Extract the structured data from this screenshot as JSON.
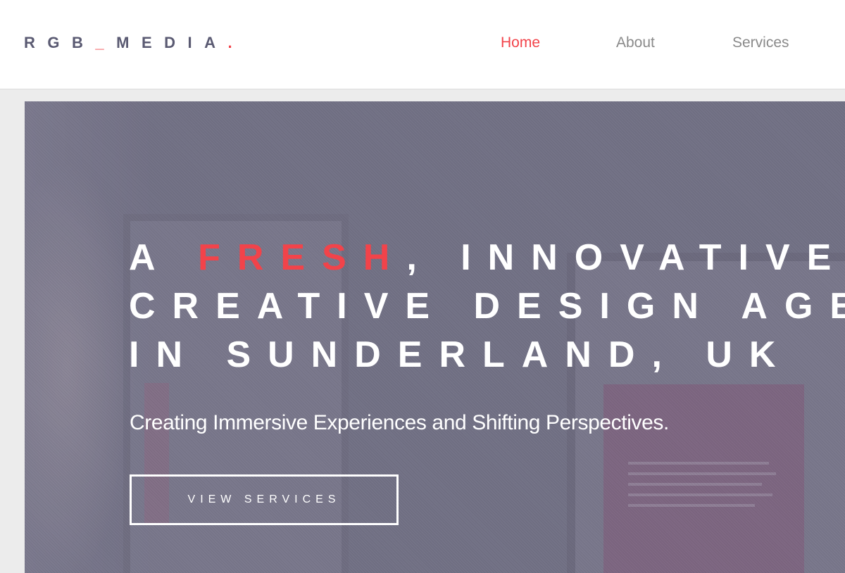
{
  "header": {
    "logo": {
      "part1": "RGB",
      "part2": "_",
      "part3": "MEDIA",
      "part4": "."
    },
    "nav": [
      {
        "label": "Home",
        "active": true
      },
      {
        "label": "About",
        "active": false
      },
      {
        "label": "Services",
        "active": false
      }
    ]
  },
  "hero": {
    "headline": {
      "line1_pre": "A ",
      "line1_accent": "FRESH",
      "line1_post": ", INNOVATIVE",
      "line2": "CREATIVE DESIGN AGENCY",
      "line3": "IN SUNDERLAND, UK"
    },
    "subtitle": "Creating Immersive Experiences and Shifting Perspectives.",
    "cta_label": "VIEW SERVICES"
  },
  "colors": {
    "accent": "#f2434a",
    "nav_inactive": "#8a8a8a",
    "logo": "#5a5a72",
    "hero_overlay": "#7b7a8d"
  }
}
